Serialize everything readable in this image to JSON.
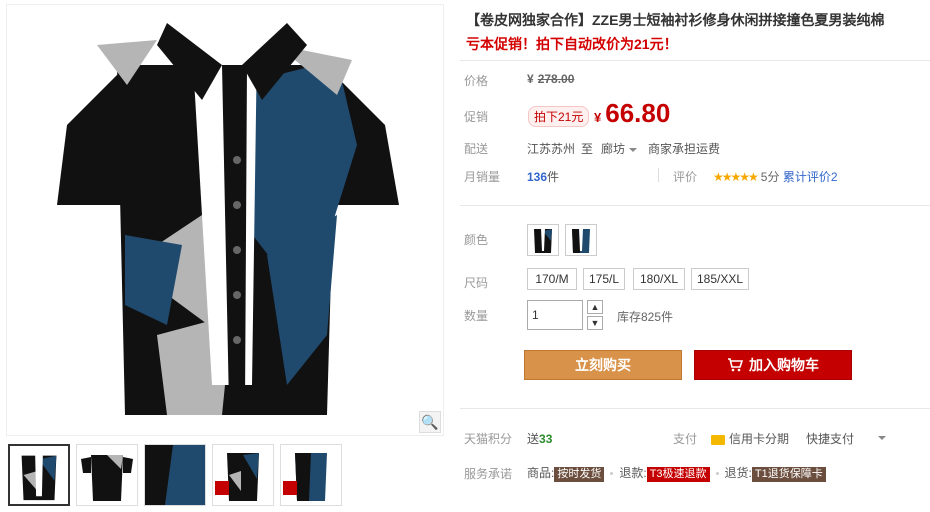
{
  "product": {
    "title": "【卷皮网独家合作】ZZE男士短袖衬衫修身休闲拼接撞色夏男装纯棉",
    "promo": "亏本促销！拍下自动改价为21元！"
  },
  "price": {
    "label": "价格",
    "currency": "¥",
    "original": "278.00"
  },
  "sale": {
    "label": "促销",
    "badge": "拍下21元",
    "currency": "¥",
    "value": "66.80"
  },
  "delivery": {
    "label": "配送",
    "from": "江苏苏州",
    "to_word": "至",
    "destination": "廊坊",
    "shipping": "商家承担运费"
  },
  "sales": {
    "label": "月销量",
    "count": "136",
    "unit": "件"
  },
  "rating": {
    "label": "评价",
    "stars": "★★★★★",
    "score": "5分",
    "total_link": "累计评价2"
  },
  "color": {
    "label": "颜色"
  },
  "size": {
    "label": "尺码",
    "options": [
      "170/M",
      "175/L",
      "180/XL",
      "185/XXL"
    ]
  },
  "quantity": {
    "label": "数量",
    "value": "1",
    "up": "▲",
    "down": "▼",
    "stock": "库存825件"
  },
  "buttons": {
    "buy_now": "立刻购买",
    "add_cart": "加入购物车"
  },
  "points": {
    "label": "天猫积分",
    "prefix": "送",
    "value": "33"
  },
  "payment": {
    "label": "支付",
    "card": "信用卡分期",
    "quick": "快捷支付"
  },
  "service": {
    "label": "服务承诺",
    "goods_prefix": "商品:",
    "goods_tag": "按时发货",
    "refund_prefix": "退款:",
    "refund_tag": "T3极速退款",
    "return_prefix": "退货:",
    "return_tag": "T1退货保障卡"
  },
  "colors": {
    "accent_red": "#c40000",
    "buy_orange": "#d8924a",
    "link_blue": "#3366cc",
    "shirt_black": "#111111",
    "shirt_blue": "#1f4a6e",
    "shirt_gray": "#b5b5b5"
  },
  "icons": {
    "zoom": "magnifier-icon",
    "cart": "cart-icon"
  }
}
